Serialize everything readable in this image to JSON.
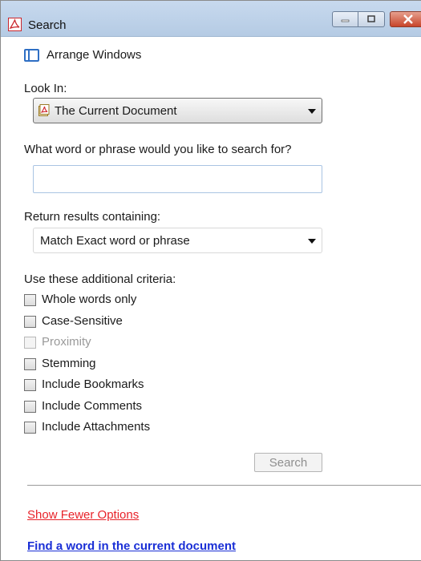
{
  "window": {
    "title": "Search",
    "arrange_label": "Arrange Windows"
  },
  "look_in": {
    "label": "Look In:",
    "selected": "The Current Document"
  },
  "query": {
    "label": "What word or phrase would you like to search for?",
    "value": ""
  },
  "return_results": {
    "label": "Return results containing:",
    "selected": "Match Exact word or phrase"
  },
  "criteria": {
    "label": "Use these additional criteria:",
    "items": [
      {
        "label": "Whole words only",
        "checked": false,
        "enabled": true
      },
      {
        "label": "Case-Sensitive",
        "checked": false,
        "enabled": true
      },
      {
        "label": "Proximity",
        "checked": false,
        "enabled": false
      },
      {
        "label": "Stemming",
        "checked": false,
        "enabled": true
      },
      {
        "label": "Include Bookmarks",
        "checked": false,
        "enabled": true
      },
      {
        "label": "Include Comments",
        "checked": false,
        "enabled": true
      },
      {
        "label": "Include Attachments",
        "checked": false,
        "enabled": true
      }
    ]
  },
  "search_button_label": "Search",
  "links": {
    "fewer_options": "Show Fewer Options",
    "find_word": "Find a word in the current document"
  },
  "colors": {
    "titlebar": "#c7d9ee",
    "link_red": "#e8232a",
    "link_blue": "#1a2fd6",
    "close_button": "#c8452a"
  }
}
